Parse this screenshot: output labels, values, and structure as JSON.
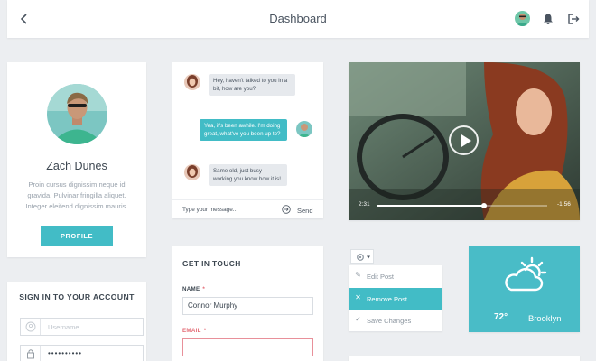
{
  "header": {
    "title": "Dashboard"
  },
  "profile": {
    "name": "Zach Dunes",
    "bio": "Proin cursus dignissim neque id gravida. Pulvinar fringilla aliquet. Integer eleifend dignissim mauris.",
    "button_label": "PROFILE"
  },
  "signin": {
    "title": "SIGN IN TO YOUR ACCOUNT",
    "username_placeholder": "Username",
    "password_value": "••••••••••"
  },
  "chat": {
    "messages": [
      {
        "direction": "in",
        "text": "Hey, haven't talked to you in a bit, how are you?"
      },
      {
        "direction": "out",
        "text": "Yea, it's been awhile. I'm doing great, what've you been up to?"
      },
      {
        "direction": "in",
        "text": "Same old, just busy working you know how it is!"
      }
    ],
    "input_placeholder": "Type your message...",
    "send_label": "Send"
  },
  "video": {
    "elapsed": "2:31",
    "remaining": "-1:56",
    "progress": 0.63
  },
  "contact": {
    "title": "GET IN TOUCH",
    "name_label": "NAME",
    "name_value": "Connor Murphy",
    "email_label": "EMAIL",
    "required_mark": "*"
  },
  "menu": {
    "items": [
      {
        "label": "Edit Post",
        "icon": "pencil-icon",
        "active": false
      },
      {
        "label": "Remove Post",
        "icon": "close-icon",
        "active": true
      },
      {
        "label": "Save Changes",
        "icon": "check-icon",
        "active": false
      }
    ]
  },
  "weather": {
    "temp": "72°",
    "city": "Brooklyn",
    "icon": "partly-cloudy-icon"
  },
  "colors": {
    "accent": "#42bcc6",
    "error": "#e36a74",
    "background": "#eceef1",
    "text": "#3c4650"
  }
}
